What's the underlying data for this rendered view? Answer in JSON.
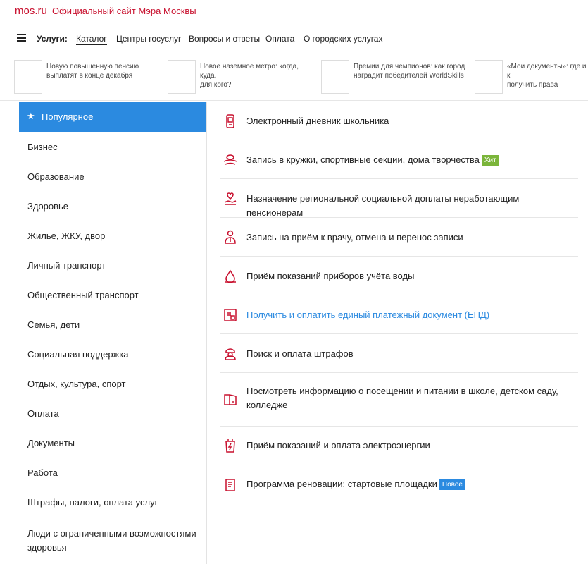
{
  "header": {
    "logo": "mos.ru",
    "site_title": "Официальный сайт Мэра Москвы"
  },
  "nav": {
    "label": "Услуги:",
    "links": [
      "Каталог",
      "Центры госуслуг",
      "Вопросы и ответы",
      "Оплата",
      "О городских услугах"
    ]
  },
  "news": [
    {
      "line1": "Новую повышенную пенсию",
      "line2": "выплатят в конце декабря"
    },
    {
      "line1": "Новое наземное метро: когда, куда,",
      "line2": "для кого?"
    },
    {
      "line1": "Премии для чемпионов: как город",
      "line2": "наградит победителей WorldSkills"
    },
    {
      "line1": "«Мои документы»: где и к",
      "line2": "получить права"
    }
  ],
  "sidebar": {
    "active": "Популярное",
    "items": [
      "Бизнес",
      "Образование",
      "Здоровье",
      "Жилье, ЖКУ, двор",
      "Личный транспорт",
      "Общественный транспорт",
      "Семья, дети",
      "Социальная поддержка",
      "Отдых, культура, спорт",
      "Оплата",
      "Документы",
      "Работа",
      "Штрафы, налоги, оплата услуг",
      "Люди с ограниченными возможностями",
      "здоровья"
    ]
  },
  "services": [
    {
      "text": "Электронный дневник школьника",
      "icon": "phone-icon"
    },
    {
      "text": "Запись в кружки, спортивные секции, дома творчества",
      "badge": "Хит",
      "icon": "hands-icon"
    },
    {
      "text": "Назначение региональной социальной доплаты неработающим пенсионерам",
      "icon": "heart-hand-icon"
    },
    {
      "text": "Запись на приём к врачу, отмена и перенос записи",
      "icon": "doctor-icon"
    },
    {
      "text": "Приём показаний приборов учёта воды",
      "icon": "water-drop-icon"
    },
    {
      "text": "Получить и оплатить единый платежный документ (ЕПД)",
      "icon": "document-icon"
    },
    {
      "text": "Поиск и оплата штрафов",
      "icon": "police-icon"
    },
    {
      "text1": "Посмотреть информацию о посещении и питании в школе, детском саду,",
      "text2": "колледже",
      "icon": "book-icon"
    },
    {
      "text": "Приём показаний и оплата электроэнергии",
      "icon": "electricity-icon"
    },
    {
      "text": "Программа реновации: стартовые площадки",
      "badge": "Новое",
      "icon": "building-doc-icon"
    }
  ],
  "colors": {
    "brand_red": "#c8102e",
    "accent_blue": "#2b8ae0",
    "badge_hit": "#7bb53a",
    "badge_new": "#2b8ae0"
  }
}
